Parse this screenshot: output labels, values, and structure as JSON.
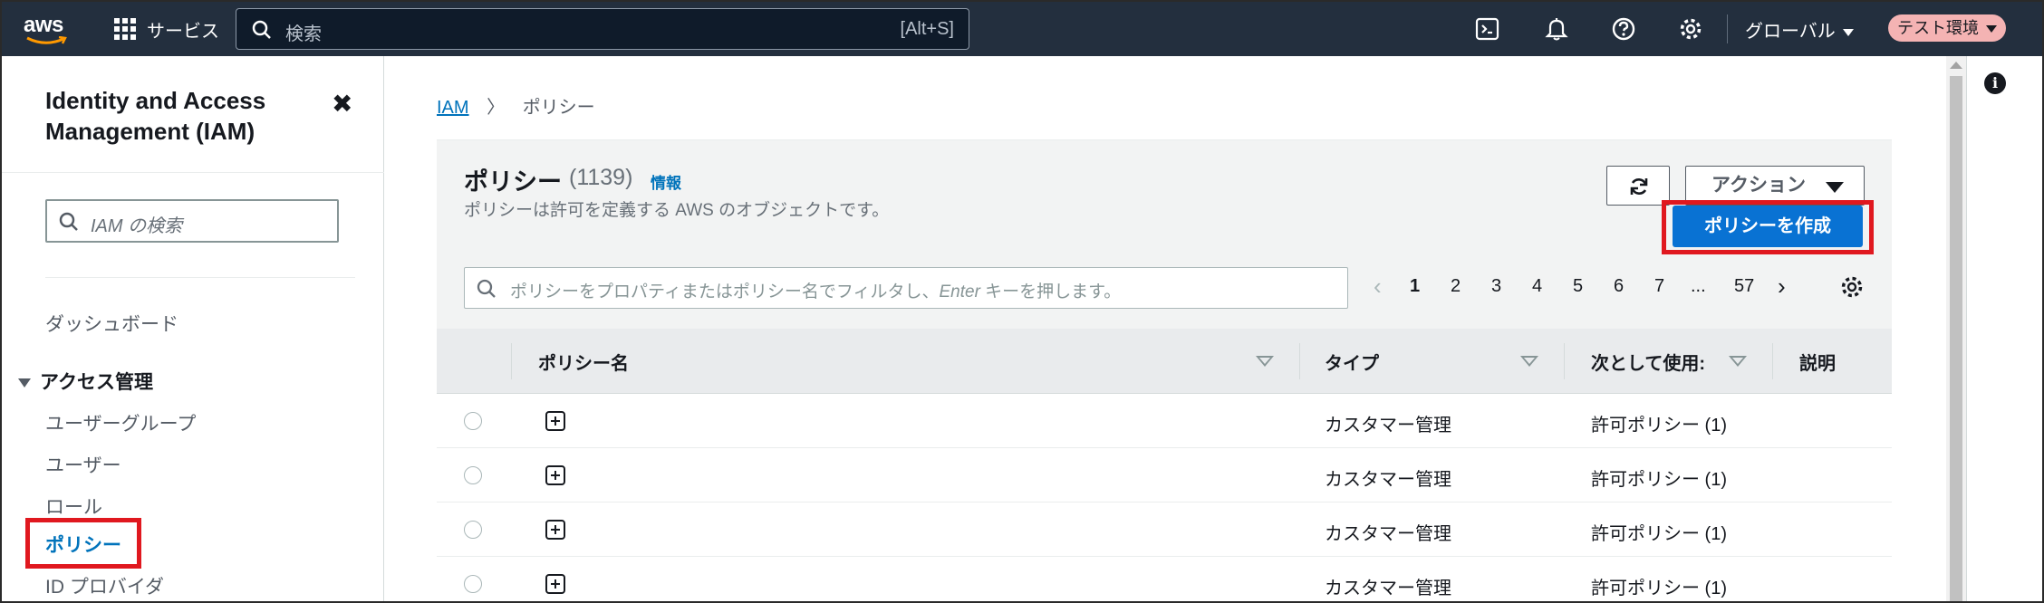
{
  "topnav": {
    "logo": "aws",
    "services": "サービス",
    "search_placeholder": "検索",
    "search_shortcut": "[Alt+S]",
    "region": "グローバル",
    "environment": "テスト環境"
  },
  "sidebar": {
    "title": "Identity and Access Management (IAM)",
    "search_placeholder": "IAM の検索",
    "dashboard": "ダッシュボード",
    "section": "アクセス管理",
    "items": [
      "ユーザーグループ",
      "ユーザー",
      "ロール",
      "ポリシー",
      "ID プロバイダ"
    ]
  },
  "breadcrumb": {
    "root": "IAM",
    "current": "ポリシー"
  },
  "panel": {
    "title": "ポリシー",
    "count": "(1139)",
    "info": "情報",
    "description": "ポリシーは許可を定義する AWS のオブジェクトです。",
    "actions_label": "アクション",
    "create_label": "ポリシーを作成",
    "filter_placeholder_a": "ポリシーをプロパティまたはポリシー名でフィルタし、",
    "filter_placeholder_key": "Enter",
    "filter_placeholder_b": " キーを押します。"
  },
  "pagination": {
    "pages": [
      "1",
      "2",
      "3",
      "4",
      "5",
      "6",
      "7",
      "...",
      "57"
    ],
    "current": "1"
  },
  "table": {
    "headers": {
      "name": "ポリシー名",
      "type": "タイプ",
      "used_as": "次として使用:",
      "description": "説明"
    },
    "rows": [
      {
        "type": "カスタマー管理",
        "used_as": "許可ポリシー (1)"
      },
      {
        "type": "カスタマー管理",
        "used_as": "許可ポリシー (1)"
      },
      {
        "type": "カスタマー管理",
        "used_as": "許可ポリシー (1)"
      },
      {
        "type": "カスタマー管理",
        "used_as": "許可ポリシー (1)"
      }
    ]
  },
  "colors": {
    "nav_bg": "#232f3e",
    "link": "#0073bb",
    "primary_button": "#0972d3",
    "highlight": "#e0181f",
    "env_badge": "#f4b3b3"
  }
}
